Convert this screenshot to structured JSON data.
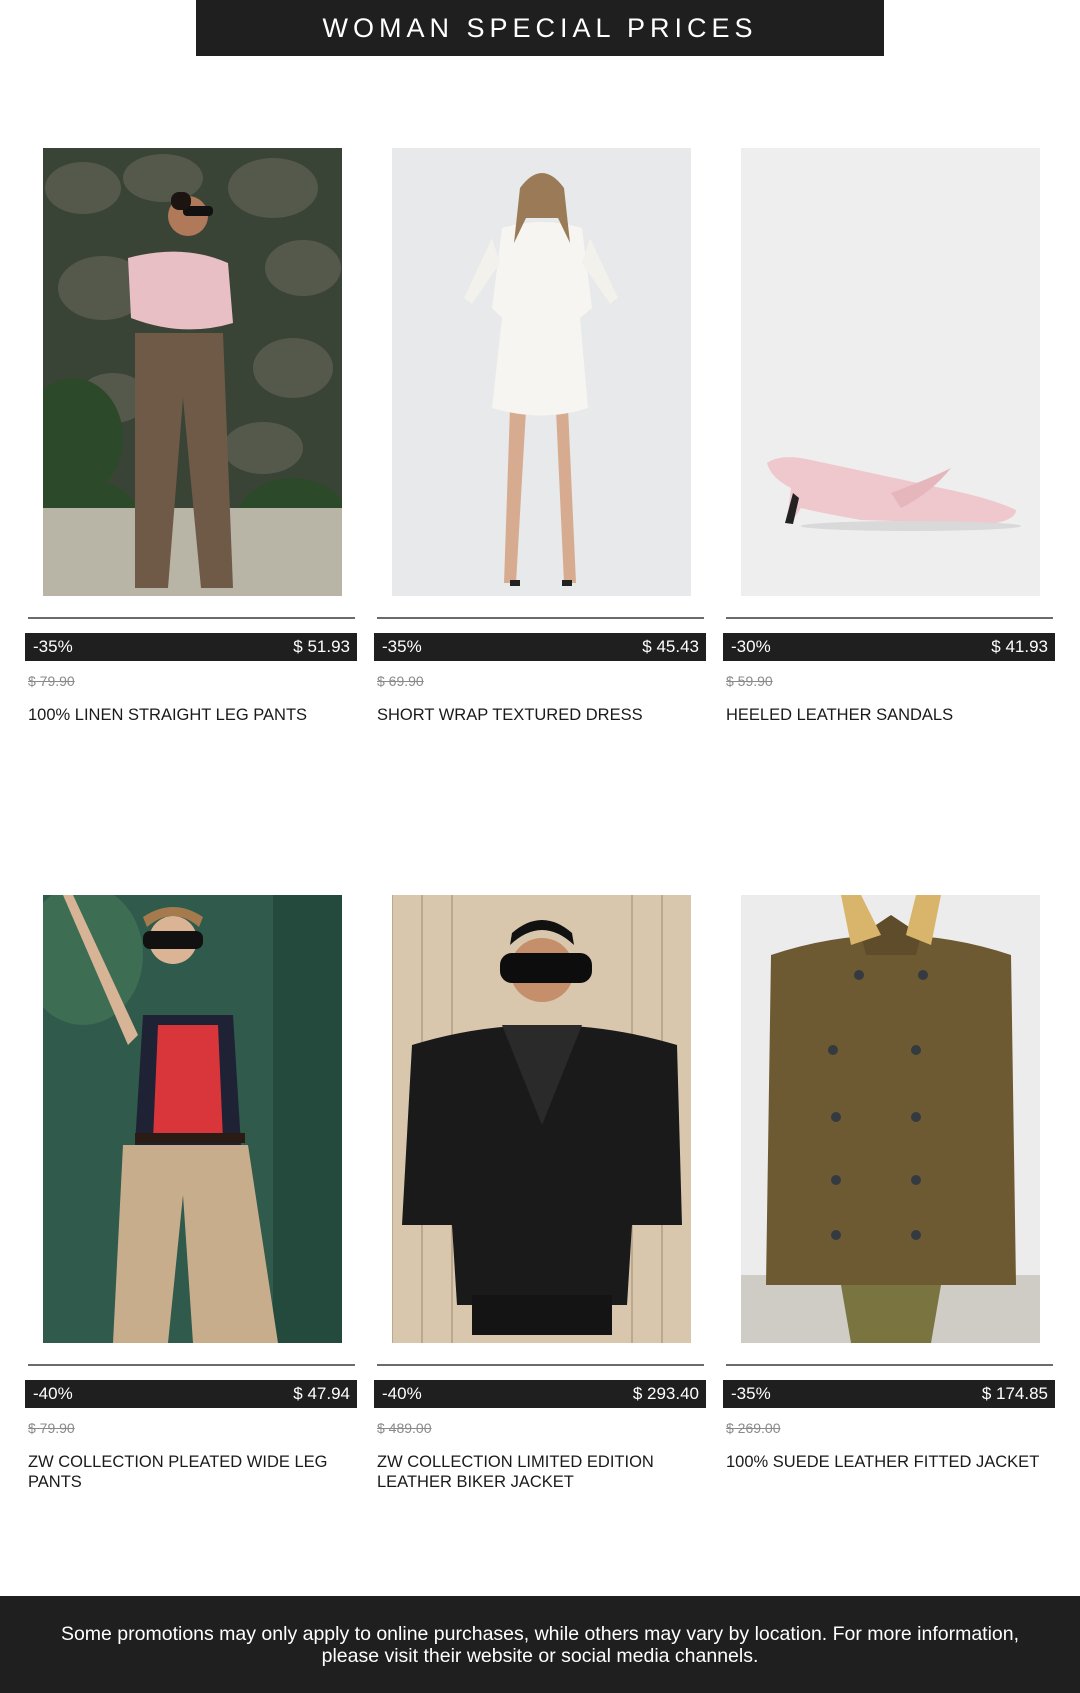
{
  "header": {
    "title": "WOMAN SPECIAL PRICES"
  },
  "products": [
    {
      "discount": "-35%",
      "price": "$ 51.93",
      "old_price": "$ 79.90",
      "name": "100% LINEN STRAIGHT LEG PANTS",
      "image": "woman-pink-shirt-brown-trousers"
    },
    {
      "discount": "-35%",
      "price": "$ 45.43",
      "old_price": "$ 69.90",
      "name": "SHORT WRAP TEXTURED DRESS",
      "image": "woman-white-short-dress"
    },
    {
      "discount": "-30%",
      "price": "$ 41.93",
      "old_price": "$ 59.90",
      "name": "HEELED LEATHER SANDALS",
      "image": "pink-heeled-sandal"
    },
    {
      "discount": "-40%",
      "price": "$ 47.94",
      "old_price": "$ 79.90",
      "name": "ZW COLLECTION PLEATED WIDE LEG PANTS",
      "image": "woman-red-top-beige-pants"
    },
    {
      "discount": "-40%",
      "price": "$ 293.40",
      "old_price": "$ 489.00",
      "name": "ZW COLLECTION LIMITED EDITION LEATHER BIKER JACKET",
      "image": "woman-black-leather-jacket"
    },
    {
      "discount": "-35%",
      "price": "$ 174.85",
      "old_price": "$ 269.00",
      "name": "100% SUEDE LEATHER FITTED JACKET",
      "image": "brown-suede-jacket"
    }
  ],
  "footer": {
    "text": "Some promotions may only apply to online purchases, while others may vary by location. For more information, please visit their website or social media channels."
  },
  "colors": {
    "bar": "#1f1f1f",
    "text": "#1a1a1a",
    "muted": "#8a8a8a"
  }
}
